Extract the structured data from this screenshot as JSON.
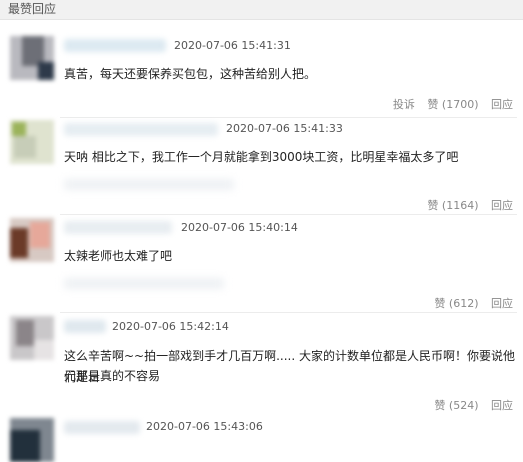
{
  "header": {
    "title": "最赞回应"
  },
  "comments": [
    {
      "time": "2020-07-06 15:41:31",
      "text": "真苦，每天还要保养买包包，这种苦给别人把。",
      "report": "投诉",
      "like": "赞 (1700)",
      "reply": "回应"
    },
    {
      "time": "2020-07-06 15:41:33",
      "text": "天呐 相比之下，我工作一个月就能拿到3000块工资，比明星幸福太多了吧",
      "like": "赞 (1164)",
      "reply": "回应"
    },
    {
      "time": "2020-07-06 15:40:14",
      "text": "太辣老师也太难了吧",
      "like": "赞 (612)",
      "reply": "回应"
    },
    {
      "time": "2020-07-06 15:42:14",
      "text_line1": "这么辛苦啊~~拍一部戏到手才几百万啊..... 大家的计数单位都是人民币啊！你要说他们是日",
      "text_line2": "元那是真的不容易",
      "like": "赞 (524)",
      "reply": "回应"
    },
    {
      "time": "2020-07-06 15:43:06"
    }
  ]
}
